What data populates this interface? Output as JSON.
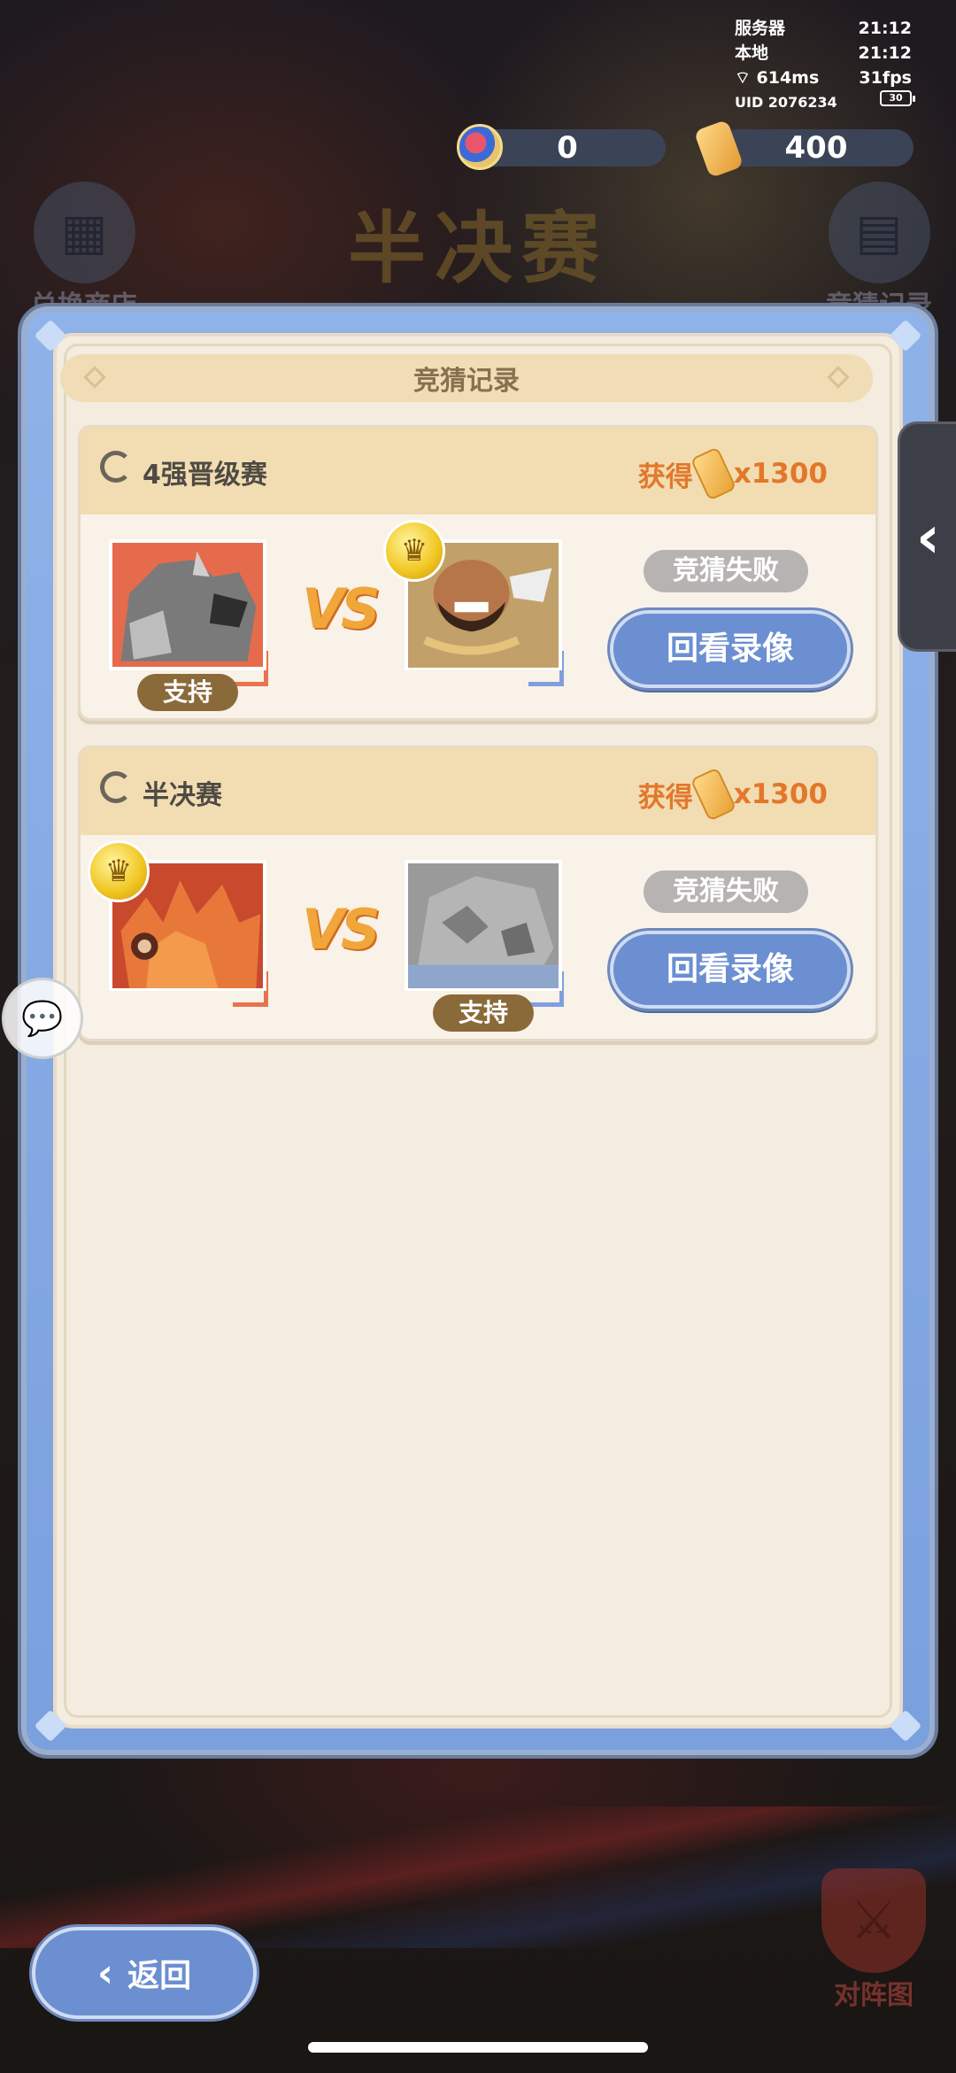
{
  "status": {
    "server_label": "服务器",
    "server_time": "21:12",
    "local_label": "本地",
    "local_time": "21:12",
    "ping": "614ms",
    "fps": "31fps",
    "uid": "UID 2076234",
    "battery": "30"
  },
  "currency": {
    "gems": "0",
    "tickets": "400"
  },
  "header": {
    "title": "半决赛",
    "shop_label": "兑换商店",
    "record_label": "竞猜记录"
  },
  "panel": {
    "title": "竞猜记录"
  },
  "records": [
    {
      "stage": "4强晋级赛",
      "reward_prefix": "获得",
      "reward_amount": "x1300",
      "support_label": "支持",
      "result": "竞猜失败",
      "replay_label": "回看录像"
    },
    {
      "stage": "半决赛",
      "reward_prefix": "获得",
      "reward_amount": "x1300",
      "support_label": "支持",
      "result": "竞猜失败",
      "replay_label": "回看录像"
    }
  ],
  "vs_label": "VS",
  "footer": {
    "back_label": "返回",
    "map_label": "对阵图"
  },
  "colors": {
    "accent_blue": "#6b8fd1",
    "reward_orange": "#e3772b",
    "panel_bg": "#f3ecdf"
  }
}
